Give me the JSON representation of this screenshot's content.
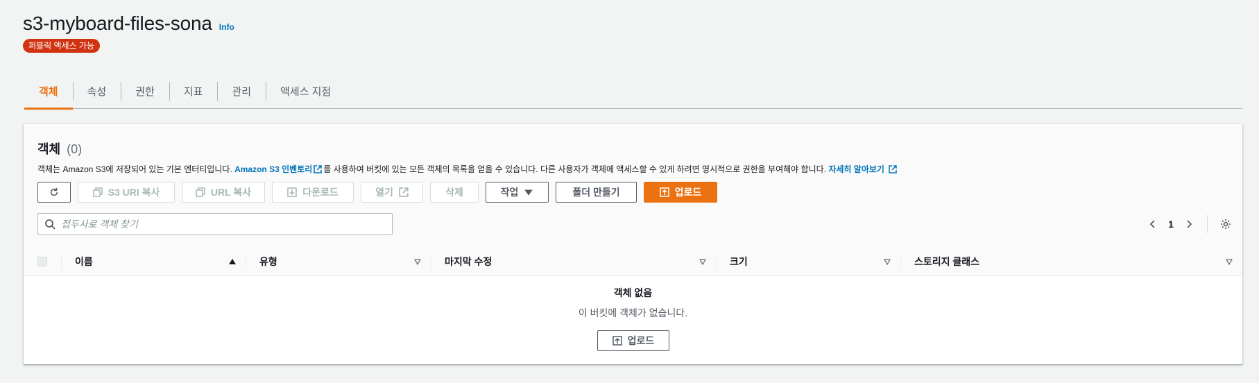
{
  "bucket": {
    "name": "s3-myboard-files-sona",
    "info_label": "Info",
    "badge": "퍼블릭 액세스 가능",
    "badge_color": "#d13212"
  },
  "tabs": [
    {
      "label": "객체",
      "active": true
    },
    {
      "label": "속성"
    },
    {
      "label": "권한"
    },
    {
      "label": "지표"
    },
    {
      "label": "관리"
    },
    {
      "label": "액세스 지점"
    }
  ],
  "objects": {
    "title": "객체",
    "count": "(0)",
    "desc_prefix": "객체는 Amazon S3에 저장되어 있는 기본 엔터티입니다. ",
    "desc_link": "Amazon S3 인벤토리",
    "desc_middle": "를 사용하여 버킷에 있는 모든 객체의 목록을 얻을 수 있습니다. 다른 사용자가 객체에 액세스할 수 있게 하려면 명시적으로 권한을 부여해야 합니다. ",
    "desc_learn": "자세히 알아보기"
  },
  "toolbar": {
    "copy_s3_uri": "S3 URI 복사",
    "copy_url": "URL 복사",
    "download": "다운로드",
    "open": "열기",
    "delete": "삭제",
    "actions": "작업",
    "create_folder": "폴더 만들기",
    "upload": "업로드",
    "accent_color": "#ec7211"
  },
  "search": {
    "placeholder": "접두사로 객체 찾기",
    "value": ""
  },
  "pagination": {
    "page": "1"
  },
  "table": {
    "columns": [
      "이름",
      "유형",
      "마지막 수정",
      "크기",
      "스토리지 클래스"
    ]
  },
  "empty": {
    "title": "객체 없음",
    "description": "이 버킷에 객체가 없습니다.",
    "upload": "업로드"
  }
}
